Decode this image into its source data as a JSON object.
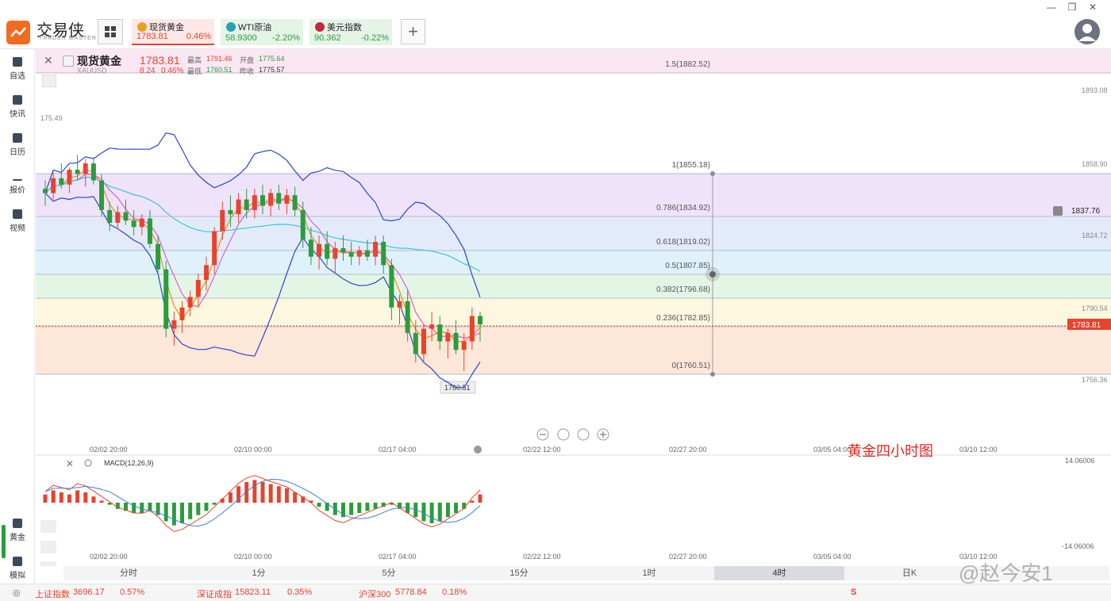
{
  "app": {
    "logo_text": "交易侠",
    "logo_sub": "TRADER MASTER"
  },
  "quotes": [
    {
      "name": "现货黄金",
      "value": "1783.81",
      "pct": "0.46%",
      "color": "#e8432e"
    },
    {
      "name": "WTI原油",
      "value": "58.9300",
      "pct": "-2.20%",
      "color": "#2a9d3a"
    },
    {
      "name": "美元指数",
      "value": "90.362",
      "pct": "-0.22%",
      "color": "#2a9d3a"
    }
  ],
  "add_label": "+",
  "sidebar": [
    {
      "label": "自选"
    },
    {
      "label": "快讯"
    },
    {
      "label": "日历"
    },
    {
      "label": "报价"
    },
    {
      "label": "视频"
    }
  ],
  "sidebar_bottom": [
    {
      "label": "黄金"
    },
    {
      "label": "模拟"
    }
  ],
  "symbol": {
    "name": "现货黄金",
    "code": "XAUUSD",
    "price": "1783.81",
    "change": "8.24",
    "change_pct": "0.46%",
    "high_label": "最高",
    "high": "1791.46",
    "open_label": "开盘",
    "open": "1775.64",
    "low_label": "最低",
    "low": "1760.51",
    "prev_label": "昨收",
    "prev": "1775.57"
  },
  "price_axis": [
    "1893.08",
    "1858.90",
    "1824.72",
    "1790.54",
    "1756.36"
  ],
  "price_tag_current": "1783.81",
  "price_tag_alert": "1837.76",
  "left_tag": "175.49",
  "fib_levels": [
    {
      "label": "1.5(1882.52)"
    },
    {
      "label": "1(1855.18)"
    },
    {
      "label": "0.786(1834.92)"
    },
    {
      "label": "0.618(1819.02)"
    },
    {
      "label": "0.5(1807.85)"
    },
    {
      "label": "0.382(1796.68)"
    },
    {
      "label": "0.236(1782.85)"
    },
    {
      "label": "0(1760.51)"
    }
  ],
  "low_marker": "1760.51",
  "x_axis": [
    "02/02 20:00",
    "02/10 00:00",
    "02/17 04:00",
    "02/22 12:00",
    "02/27 20:00",
    "03/05 04:00",
    "03/10 12:00"
  ],
  "macd": {
    "title": "MACD(12,26,9)",
    "top": "14.06006",
    "bottom": "-14.06006"
  },
  "periods": [
    "分时",
    "1分",
    "5分",
    "15分",
    "1时",
    "4时",
    "日K"
  ],
  "active_period": "4时",
  "annotation": "黄金四小时图",
  "watermark": "@赵今安1",
  "status": [
    {
      "name": "上证指数",
      "value": "3696.17",
      "pct": "0.57%"
    },
    {
      "name": "深证成指",
      "value": "15823.11",
      "pct": "0.35%"
    },
    {
      "name": "沪深300",
      "value": "5778.84",
      "pct": "0.18%"
    }
  ],
  "colors": {
    "up": "#e8432e",
    "down": "#2a9d3a",
    "accent": "#f26b21"
  },
  "chart_data": {
    "type": "candlestick",
    "title": "",
    "ylim": [
      1752,
      1895
    ],
    "candles": [
      [
        1848,
        1852,
        1840,
        1846
      ],
      [
        1846,
        1856,
        1843,
        1853
      ],
      [
        1853,
        1860,
        1848,
        1850
      ],
      [
        1850,
        1858,
        1846,
        1857
      ],
      [
        1857,
        1864,
        1852,
        1855
      ],
      [
        1855,
        1862,
        1849,
        1860
      ],
      [
        1860,
        1863,
        1850,
        1852
      ],
      [
        1852,
        1855,
        1835,
        1838
      ],
      [
        1838,
        1842,
        1828,
        1832
      ],
      [
        1832,
        1840,
        1829,
        1837
      ],
      [
        1837,
        1843,
        1831,
        1833
      ],
      [
        1833,
        1838,
        1826,
        1830
      ],
      [
        1830,
        1836,
        1826,
        1834
      ],
      [
        1834,
        1838,
        1820,
        1822
      ],
      [
        1822,
        1826,
        1808,
        1810
      ],
      [
        1810,
        1814,
        1778,
        1782
      ],
      [
        1782,
        1790,
        1774,
        1786
      ],
      [
        1786,
        1795,
        1780,
        1792
      ],
      [
        1792,
        1800,
        1788,
        1797
      ],
      [
        1797,
        1808,
        1792,
        1805
      ],
      [
        1805,
        1816,
        1800,
        1812
      ],
      [
        1812,
        1830,
        1808,
        1828
      ],
      [
        1828,
        1842,
        1824,
        1838
      ],
      [
        1838,
        1845,
        1830,
        1836
      ],
      [
        1836,
        1846,
        1832,
        1843
      ],
      [
        1843,
        1848,
        1834,
        1838
      ],
      [
        1838,
        1848,
        1834,
        1845
      ],
      [
        1845,
        1850,
        1836,
        1840
      ],
      [
        1840,
        1848,
        1835,
        1846
      ],
      [
        1846,
        1850,
        1838,
        1841
      ],
      [
        1841,
        1848,
        1836,
        1845
      ],
      [
        1845,
        1849,
        1835,
        1838
      ],
      [
        1838,
        1842,
        1820,
        1824
      ],
      [
        1824,
        1830,
        1812,
        1816
      ],
      [
        1816,
        1826,
        1810,
        1822
      ],
      [
        1822,
        1828,
        1812,
        1815
      ],
      [
        1815,
        1823,
        1808,
        1820
      ],
      [
        1820,
        1826,
        1814,
        1818
      ],
      [
        1818,
        1823,
        1812,
        1816
      ],
      [
        1816,
        1821,
        1812,
        1819
      ],
      [
        1819,
        1824,
        1814,
        1816
      ],
      [
        1816,
        1826,
        1812,
        1823
      ],
      [
        1823,
        1826,
        1808,
        1812
      ],
      [
        1812,
        1815,
        1786,
        1792
      ],
      [
        1792,
        1798,
        1784,
        1795
      ],
      [
        1795,
        1800,
        1776,
        1780
      ],
      [
        1780,
        1786,
        1766,
        1770
      ],
      [
        1770,
        1784,
        1766,
        1782
      ],
      [
        1782,
        1790,
        1776,
        1784
      ],
      [
        1784,
        1788,
        1772,
        1776
      ],
      [
        1776,
        1782,
        1768,
        1780
      ],
      [
        1780,
        1786,
        1770,
        1772
      ],
      [
        1772,
        1780,
        1762,
        1776
      ],
      [
        1776,
        1792,
        1772,
        1788
      ],
      [
        1788,
        1790,
        1776,
        1784
      ]
    ],
    "macd_hist": [
      4,
      6,
      5,
      4,
      6,
      5,
      3,
      1,
      -1,
      -3,
      -4,
      -5,
      -5,
      -4,
      -6,
      -9,
      -11,
      -10,
      -8,
      -6,
      -4,
      -1,
      2,
      5,
      8,
      10,
      11,
      10,
      9,
      8,
      7,
      5,
      3,
      1,
      -2,
      -4,
      -6,
      -7,
      -6,
      -5,
      -4,
      -3,
      -2,
      -1,
      -3,
      -5,
      -7,
      -9,
      -10,
      -9,
      -7,
      -5,
      -3,
      1,
      4
    ]
  }
}
